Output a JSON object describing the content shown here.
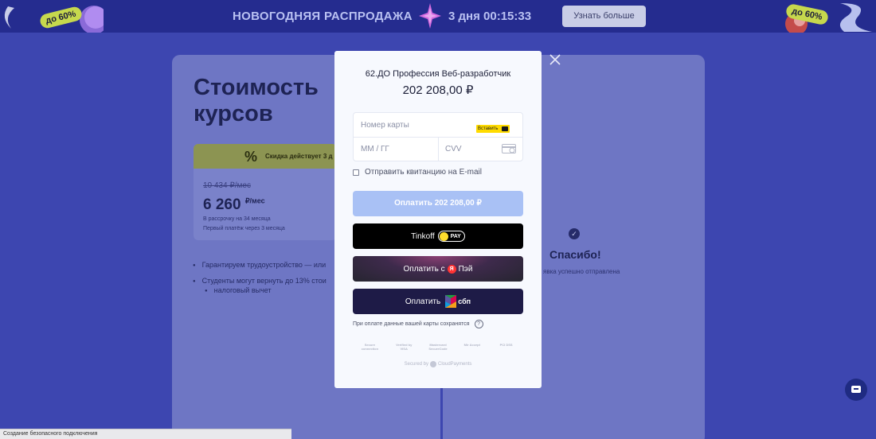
{
  "promo": {
    "badge_left": "до 60%",
    "badge_right": "до 60%",
    "title": "НОВОГОДНЯЯ РАСПРОДАЖА",
    "timer": "3 дня 00:15:33",
    "button": "Узнать больше"
  },
  "background": {
    "title_line1": "Стоимость",
    "title_line2": "курсов",
    "discount_icon": "%",
    "discount_text": "Скидка действует 3 д",
    "old_price": "10 434 ₽/мес",
    "price": "6 260",
    "price_unit": "₽/мес",
    "note1": "В рассрочку на 34 месяца",
    "note2": "Первый платёж через 3 месяца",
    "bullet1": "Гарантируем трудоустройство — или",
    "bullet2": "Студенты могут вернуть до 13% стои",
    "bullet2_cont": "налоговый вычет",
    "thanks": "Спасибо!",
    "sent": "явка успешно отправлена"
  },
  "modal": {
    "title": "62.ДО Профессия Веб-разработчик",
    "amount": "202 208,00 ₽",
    "card_number_placeholder": "Номер карты",
    "paste_label": "Вставить",
    "expiry_placeholder": "ММ / ГГ",
    "cvv_placeholder": "CVV",
    "receipt_label": "Отправить квитанцию на E-mail",
    "pay_button": "Оплатить 202 208,00 ₽",
    "tinkoff_label": "Tinkoff",
    "tinkoff_pay": "PAY",
    "yandex_label": "Оплатить с",
    "yandex_mark": "Я",
    "yandex_pay": "Пэй",
    "sbp_label": "Оплатить",
    "sbp_mark": "сбп",
    "save_note": "При оплате данные вашей карты сохранятся",
    "help_mark": "?",
    "security_logos": [
      "Secure connection",
      "Verified by VISA",
      "Mastercard SecureCode",
      "Mir Accept",
      "PCI DSS"
    ],
    "secured_prefix": "Secured by",
    "secured_brand": "CloudPayments"
  },
  "status_bar": "Создание безопасного подключения",
  "colors": {
    "page_bg": "#3d46b0",
    "promo_bg": "#252c8f",
    "pay_button": "#a9c1f5",
    "paste_button": "#ffdb00",
    "sbp_button": "#1e1b47"
  }
}
